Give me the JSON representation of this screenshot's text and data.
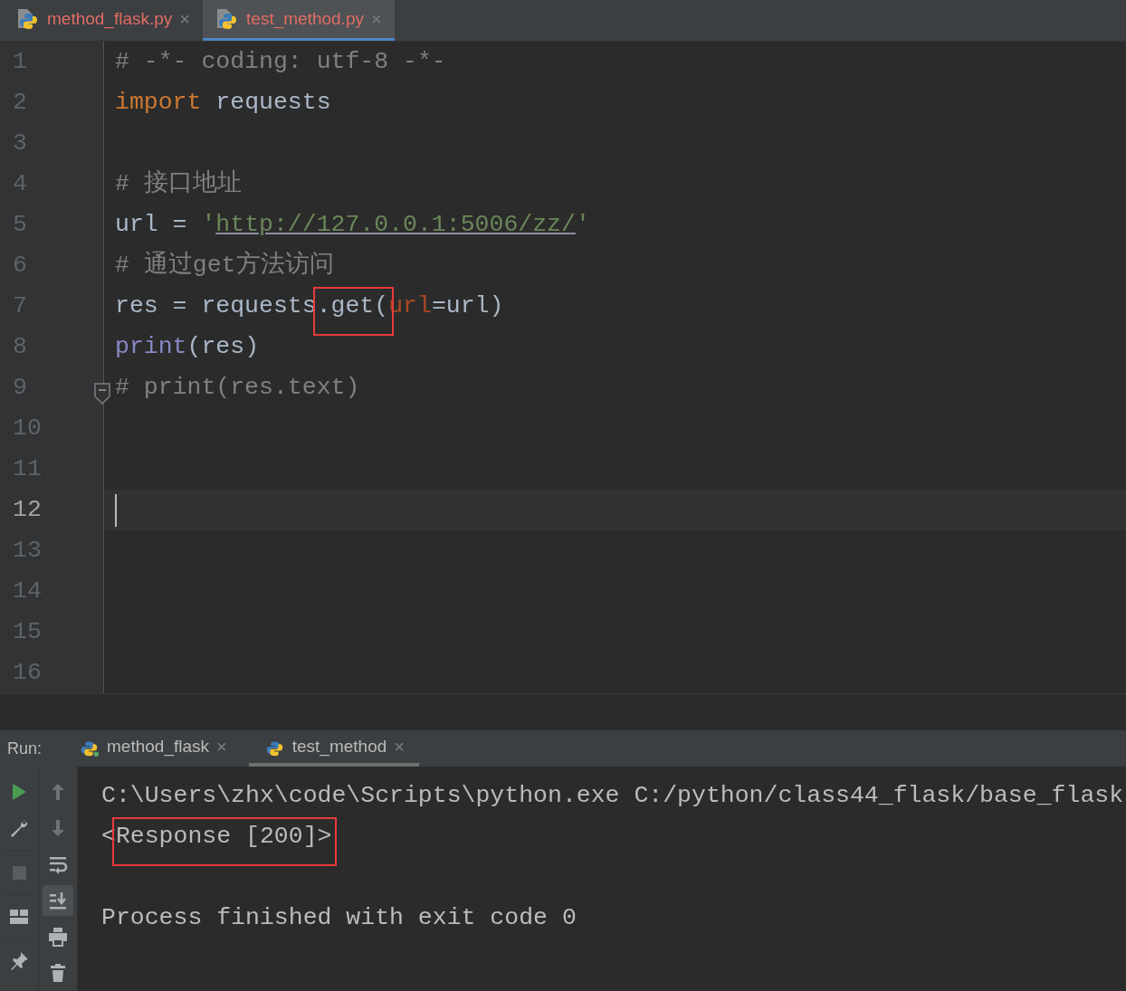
{
  "editor_tabs": [
    {
      "label": "method_flask.py",
      "selected": false,
      "close": "×"
    },
    {
      "label": "test_method.py",
      "selected": true,
      "close": "×"
    }
  ],
  "editor": {
    "lines": [
      {
        "number": "1",
        "tokens": [
          {
            "kind": "comment",
            "text": "# -*- coding: utf-8 -*-"
          }
        ]
      },
      {
        "number": "2",
        "tokens": [
          {
            "kind": "keyword",
            "text": "import"
          },
          {
            "kind": "plain",
            "text": " requests"
          }
        ]
      },
      {
        "number": "3"
      },
      {
        "number": "4",
        "tokens": [
          {
            "kind": "comment",
            "text": "# 接口地址"
          }
        ]
      },
      {
        "number": "5",
        "tokens": [
          {
            "kind": "plain",
            "text": "url = "
          },
          {
            "kind": "string",
            "text": "'"
          },
          {
            "kind": "url",
            "text": "http://127.0.0.1:5006/zz/"
          },
          {
            "kind": "string",
            "text": "'"
          }
        ]
      },
      {
        "number": "6",
        "tokens": [
          {
            "kind": "comment",
            "text": "# 通过get方法访问"
          }
        ]
      },
      {
        "number": "7",
        "tokens": [
          {
            "kind": "plain",
            "text": "res = requests"
          },
          {
            "kind": "plain",
            "text": ".get(",
            "highlighted": true
          },
          {
            "kind": "param",
            "text": "url"
          },
          {
            "kind": "plain",
            "text": "=url)"
          }
        ]
      },
      {
        "number": "8",
        "tokens": [
          {
            "kind": "builtin",
            "text": "print"
          },
          {
            "kind": "plain",
            "text": "(res)"
          }
        ]
      },
      {
        "number": "9",
        "fold": true,
        "tokens": [
          {
            "kind": "comment",
            "text": "# print(res.text)"
          }
        ]
      },
      {
        "number": "10"
      },
      {
        "number": "11"
      },
      {
        "number": "12",
        "current": true
      },
      {
        "number": "13"
      },
      {
        "number": "14"
      },
      {
        "number": "15"
      },
      {
        "number": "16"
      }
    ]
  },
  "run_panel": {
    "label": "Run:",
    "tabs": [
      {
        "label": "method_flask",
        "selected": false,
        "running": true,
        "close": "×"
      },
      {
        "label": "test_method",
        "selected": true,
        "running": false,
        "close": "×"
      }
    ],
    "tools_left": [
      {
        "kind": "rerun",
        "disabled": false
      },
      {
        "kind": "wrench",
        "disabled": false
      },
      {
        "kind": "stop",
        "disabled": true
      },
      {
        "kind": "layout",
        "disabled": false
      },
      {
        "kind": "pin",
        "disabled": false
      }
    ],
    "tools_right": [
      {
        "kind": "up",
        "disabled": true
      },
      {
        "kind": "down",
        "disabled": true
      },
      {
        "kind": "wrap",
        "selected": false
      },
      {
        "kind": "scroll-end",
        "selected": true
      },
      {
        "kind": "print",
        "selected": false
      },
      {
        "kind": "trash",
        "selected": false
      }
    ],
    "console": [
      {
        "kind": "output",
        "tokens": [
          {
            "text": "C:\\Users\\zhx\\code\\Scripts\\python.exe C:/python/class44_flask/base_flask"
          }
        ]
      },
      {
        "kind": "output",
        "tokens": [
          {
            "text": "<"
          },
          {
            "text": "Response [200]>",
            "highlighted": true
          }
        ]
      },
      {
        "kind": "status",
        "tokens": [
          {
            "text": "Process finished with exit code 0"
          }
        ]
      }
    ]
  }
}
